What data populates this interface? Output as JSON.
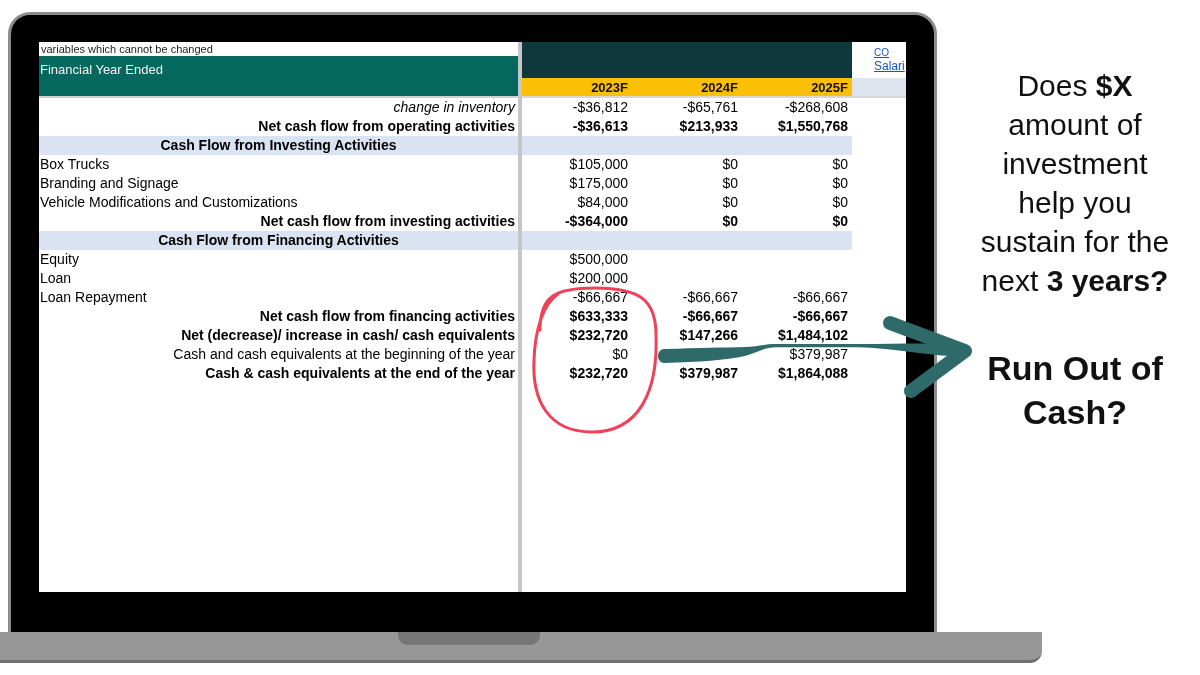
{
  "sheet": {
    "note": "variables which cannot be changed",
    "links": [
      "CO",
      "Salari"
    ],
    "header_label": "Financial Year Ended",
    "years": [
      "2023F",
      "2024F",
      "2025F"
    ],
    "rows": [
      {
        "kind": "adjustment",
        "label": "change in inventory",
        "fy2023": "-$36,812",
        "fy2024": "-$65,761",
        "fy2025": "-$268,608"
      },
      {
        "kind": "total",
        "label": "Net cash flow from operating activities",
        "fy2023": "-$36,613",
        "fy2024": "$213,933",
        "fy2025": "$1,550,768"
      },
      {
        "kind": "section",
        "label": "Cash Flow from Investing Activities"
      },
      {
        "kind": "item",
        "label": "Box Trucks",
        "fy2023": "$105,000",
        "fy2024": "$0",
        "fy2025": "$0"
      },
      {
        "kind": "item",
        "label": "Branding and Signage",
        "fy2023": "$175,000",
        "fy2024": "$0",
        "fy2025": "$0"
      },
      {
        "kind": "item",
        "label": "Vehicle Modifications and Customizations",
        "fy2023": "$84,000",
        "fy2024": "$0",
        "fy2025": "$0"
      },
      {
        "kind": "total",
        "label": "Net cash flow from investing activities",
        "fy2023": "-$364,000",
        "fy2024": "$0",
        "fy2025": "$0"
      },
      {
        "kind": "section",
        "label": "Cash Flow from Financing Activities"
      },
      {
        "kind": "item",
        "label": "Equity",
        "fy2023": "$500,000"
      },
      {
        "kind": "item",
        "label": "Loan",
        "fy2023": "$200,000"
      },
      {
        "kind": "item",
        "label": "Loan Repayment",
        "fy2023": "-$66,667",
        "fy2024": "-$66,667",
        "fy2025": "-$66,667"
      },
      {
        "kind": "total",
        "label": "Net cash flow from financing activities",
        "fy2023": "$633,333",
        "fy2024": "-$66,667",
        "fy2025": "-$66,667"
      },
      {
        "kind": "total",
        "label": "Net (decrease)/ increase in cash/ cash equivalents",
        "fy2023": "$232,720",
        "fy2024": "$147,266",
        "fy2025": "$1,484,102"
      },
      {
        "kind": "balance",
        "label": "Cash and cash equivalents at the beginning of the year",
        "fy2023": "$0",
        "fy2025": "$379,987"
      },
      {
        "kind": "total",
        "label": "Cash & cash equivalents at the end of the year",
        "fy2023": "$232,720",
        "fy2024": "$379,987",
        "fy2025": "$1,864,088"
      }
    ]
  },
  "callout": {
    "question": "Does **$X** amount of investment help you sustain for the next **3 years?**",
    "answer": "Run Out of Cash?"
  }
}
